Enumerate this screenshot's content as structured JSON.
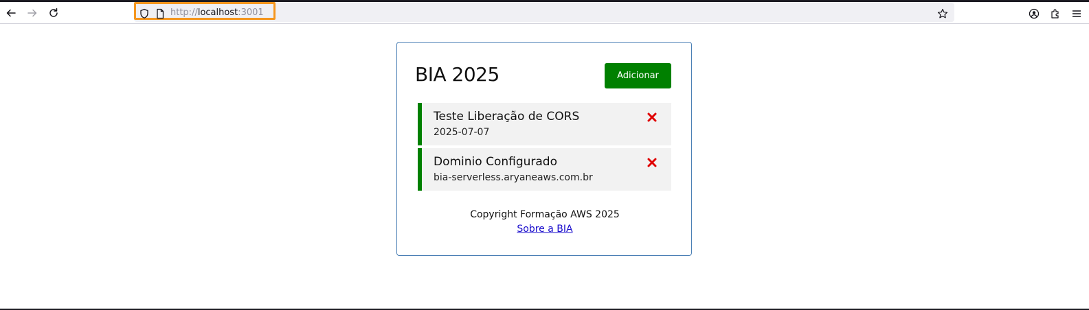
{
  "browser": {
    "url_scheme": "http://",
    "url_host": "localhost",
    "url_port": ":3001",
    "icons": {
      "back": "arrow-left-icon",
      "forward": "arrow-right-icon",
      "reload": "reload-icon",
      "shield": "shield-icon",
      "page": "page-icon",
      "bookmark": "star-icon",
      "account": "account-icon",
      "extensions": "puzzle-icon",
      "menu": "hamburger-menu-icon"
    },
    "highlight_color": "#f5961e"
  },
  "app": {
    "title": "BIA 2025",
    "add_button_label": "Adicionar",
    "accent_color": "#008000",
    "delete_color": "#e00000",
    "tasks": [
      {
        "title": "Teste Liberação de CORS",
        "subtitle": "2025-07-07"
      },
      {
        "title": "Dominio Configurado",
        "subtitle": "bia-serverless.aryaneaws.com.br"
      }
    ],
    "footer_text": "Copyright Formação AWS 2025",
    "footer_link": "Sobre a BIA"
  }
}
